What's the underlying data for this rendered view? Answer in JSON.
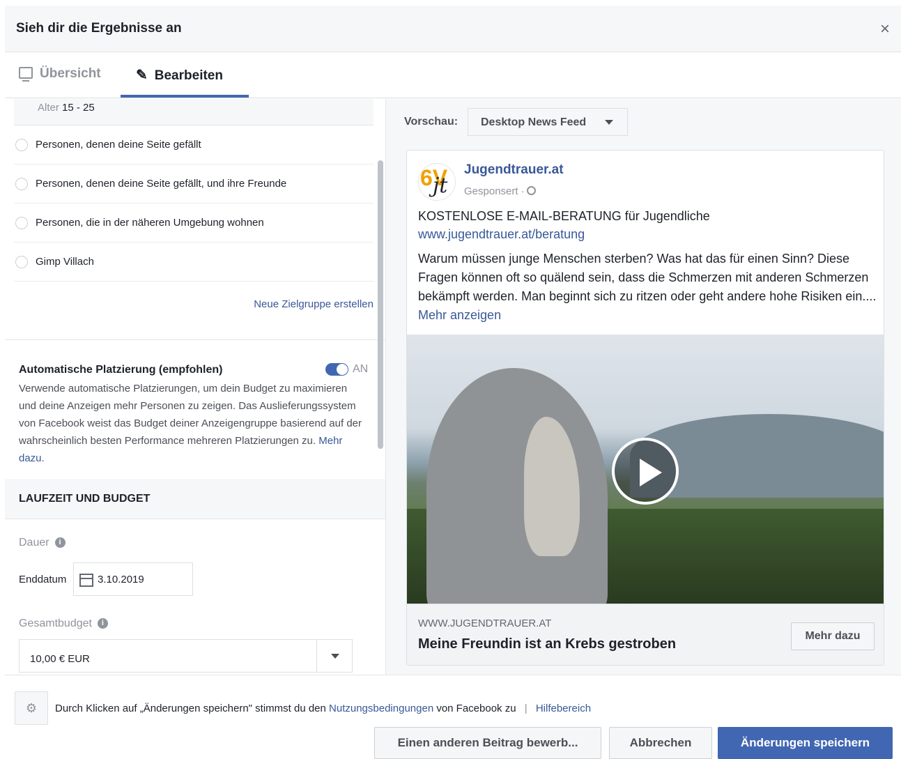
{
  "header": {
    "title": "Sieh dir die Ergebnisse an",
    "close_label": "×"
  },
  "tabs": [
    {
      "label": "Übersicht",
      "icon": "monitor-icon",
      "active": false
    },
    {
      "label": "Bearbeiten",
      "icon": "pencil-icon",
      "active": true
    }
  ],
  "audience": {
    "age_label": "Alter",
    "age_value": "15 - 25",
    "options": [
      "Personen, denen deine Seite gefällt",
      "Personen, denen deine Seite gefällt, und ihre Freunde",
      "Personen, die in der näheren Umgebung wohnen",
      "Gimp Villach"
    ],
    "new_audience_link": "Neue Zielgruppe erstellen"
  },
  "placement": {
    "title": "Automatische Platzierung (empfohlen)",
    "toggle_state": "AN",
    "description": "Verwende automatische Platzierungen, um dein Budget zu maximieren und deine Anzeigen mehr Personen zu zeigen. Das Auslieferungssystem von Facebook weist das Budget deiner Anzeigengruppe basierend auf der wahrscheinlich besten Performance mehreren Platzierungen zu.",
    "more_link": "Mehr dazu."
  },
  "budget_section": {
    "title": "LAUFZEIT UND BUDGET",
    "duration_label": "Dauer",
    "end_date_label": "Enddatum",
    "end_date_value": "3.10.2019",
    "total_budget_label": "Gesamtbudget",
    "total_budget_value": "10,00 € EUR"
  },
  "preview": {
    "label": "Vorschau:",
    "placement_select": "Desktop News Feed",
    "post": {
      "page_name": "Jugendtrauer.at",
      "sponsored": "Gesponsert ·",
      "logo_text_1": "6V",
      "logo_text_2": "jt",
      "headline": "KOSTENLOSE E-MAIL-BERATUNG für Jugendliche",
      "link": "www.jugendtrauer.at/beratung",
      "body": "Warum müssen junge Menschen sterben? Was hat das für einen Sinn? Diese Fragen können oft so quälend sein, dass die Schmerzen mit anderen Schmerzen bekämpft werden. Man beginnt sich zu ritzen oder geht andere hohe Risiken ein....",
      "more_link": "Mehr anzeigen",
      "domain": "WWW.JUGENDTRAUER.AT",
      "link_title": "Meine Freundin ist an Krebs gestroben",
      "cta_label": "Mehr dazu"
    }
  },
  "footer": {
    "gear_icon": "⚙",
    "terms_prefix": "Durch Klicken auf „Änderungen speichern\" stimmst du den",
    "terms_link": "Nutzungsbedingungen",
    "terms_suffix": "von Facebook zu",
    "separator": "|",
    "help_link": "Hilfebereich",
    "btn_boost_other": "Einen anderen Beitrag bewerb...",
    "btn_cancel": "Abbrechen",
    "btn_save": "Änderungen speichern"
  },
  "colors": {
    "accent": "#4267b2",
    "link": "#385898",
    "text": "#1d2129",
    "muted": "#90949c"
  }
}
